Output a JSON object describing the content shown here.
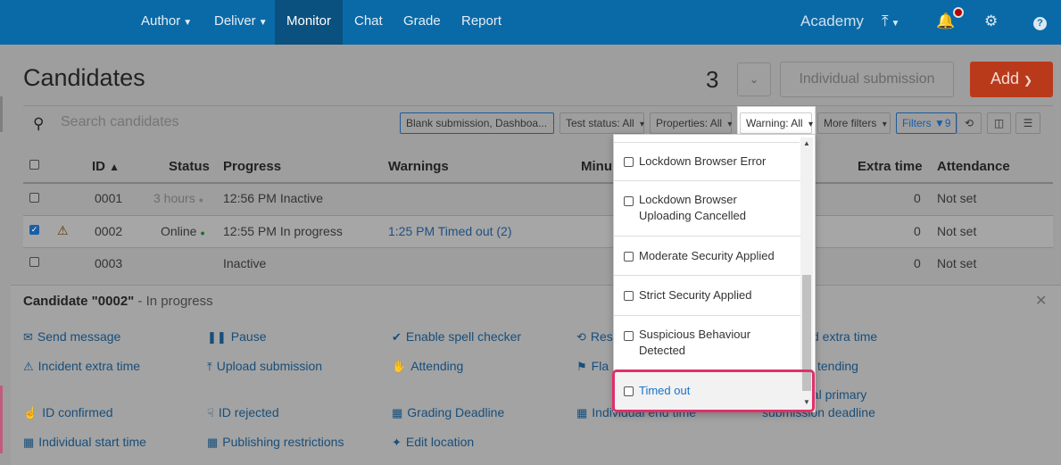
{
  "nav": {
    "items": [
      {
        "label": "Author",
        "caret": true
      },
      {
        "label": "Deliver",
        "caret": true
      },
      {
        "label": "Monitor",
        "caret": false
      },
      {
        "label": "Chat",
        "caret": false
      },
      {
        "label": "Grade",
        "caret": false
      },
      {
        "label": "Report",
        "caret": false
      }
    ],
    "active": "Monitor",
    "org_name": "Academy"
  },
  "header": {
    "title": "Candidates",
    "count": "3",
    "individual_submission_label": "Individual submission",
    "add_label": "Add"
  },
  "search": {
    "placeholder": "Search candidates"
  },
  "filters": {
    "blank_submission": "Blank submission, Dashboa...",
    "test_status": "Test status: All",
    "properties": "Properties: All",
    "warning": "Warning: All",
    "more_filters": "More filters",
    "filters_label": "Filters",
    "filters_count": "9"
  },
  "table": {
    "headers": {
      "id": "ID",
      "status": "Status",
      "progress": "Progress",
      "warnings": "Warnings",
      "minutes": "Minu",
      "extra_time": "Extra time",
      "attendance": "Attendance"
    },
    "rows": [
      {
        "id": "0001",
        "status": "3 hours",
        "progress": "12:56 PM Inactive",
        "warning": "",
        "extra": "0",
        "attendance": "Not set",
        "checked": false,
        "alert": false
      },
      {
        "id": "0002",
        "status": "Online",
        "progress": "12:55 PM In progress",
        "warning": "1:25 PM Timed out (2)",
        "extra": "0",
        "attendance": "Not set",
        "checked": true,
        "alert": true
      },
      {
        "id": "0003",
        "status": "",
        "progress": "Inactive",
        "warning": "",
        "extra": "0",
        "attendance": "Not set",
        "checked": false,
        "alert": false
      }
    ]
  },
  "panel": {
    "title_prefix": "Candidate \"0002\"",
    "title_suffix": " - In progress",
    "actions": {
      "send_message": "Send message",
      "pause": "Pause",
      "spell_checker": "Enable spell checker",
      "reset": "Res",
      "extra_time": "d extra time",
      "incident_extra_time": "Incident extra time",
      "upload_submission": "Upload submission",
      "attending": "Attending",
      "flag": "Fla",
      "not_attending": "tending",
      "id_confirmed": "ID confirmed",
      "id_rejected": "ID rejected",
      "grading_deadline": "Grading Deadline",
      "individual_end_time": "Individual end time",
      "primary_deadline_1": "ual primary",
      "primary_deadline_2": "submission deadline",
      "individual_start_time": "Individual start time",
      "publishing_restrictions": "Publishing restrictions",
      "edit_location": "Edit location"
    }
  },
  "warning_dropdown": {
    "options": [
      "Lockdown Browser Error",
      "Lockdown Browser Uploading Cancelled",
      "Moderate Security Applied",
      "Strict Security Applied",
      "Suspicious Behaviour Detected",
      "Timed out"
    ],
    "highlighted": "Timed out"
  },
  "colors": {
    "topbar": "#0a6aa7",
    "add_button": "#b93a1b",
    "highlight_border": "#e0306a",
    "link": "#1a73c8"
  }
}
